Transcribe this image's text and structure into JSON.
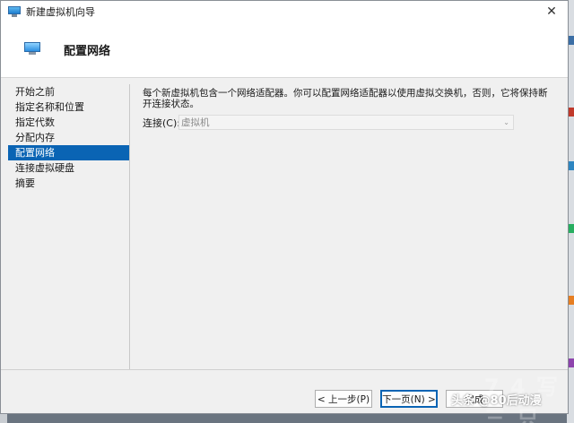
{
  "window": {
    "title": "新建虚拟机向导",
    "close_glyph": "✕"
  },
  "header": {
    "title": "配置网络"
  },
  "nav": {
    "items": [
      {
        "label": "开始之前"
      },
      {
        "label": "指定名称和位置"
      },
      {
        "label": "指定代数"
      },
      {
        "label": "分配内存"
      },
      {
        "label": "配置网络",
        "active": true
      },
      {
        "label": "连接虚拟硬盘"
      },
      {
        "label": "摘要"
      }
    ]
  },
  "content": {
    "description": "每个新虚拟机包含一个网络适配器。你可以配置网络适配器以使用虚拟交换机，否则，它将保持断开连接状态。",
    "connection_label": "连接(C):",
    "connection_value": "虚拟机",
    "dropdown_glyph": "⌄"
  },
  "footer": {
    "prev_label": "< 上一步(P)",
    "next_label": "下一页(N) >",
    "finish_label": "完成"
  },
  "watermark": {
    "text": "头条 @80后动漫",
    "deco": "7 4 写 三 只"
  },
  "colors": {
    "selection": "#0a64b4",
    "window_bg": "#f0f0f0"
  }
}
